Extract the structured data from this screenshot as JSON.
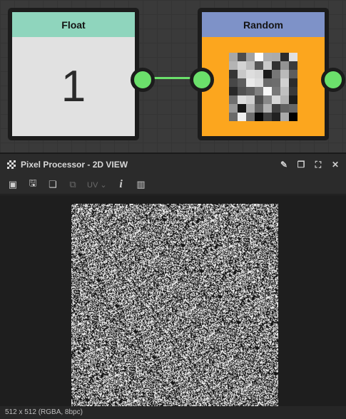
{
  "graph": {
    "nodes": [
      {
        "title": "Float",
        "value": "1",
        "header_color": "#8fd5bd",
        "body_color": "#e1e1e1"
      },
      {
        "title": "Random",
        "header_color": "#7e92c8",
        "body_color": "#fca61e"
      }
    ],
    "port_color": "#6be06b"
  },
  "panel": {
    "title": "Pixel Processor - 2D VIEW",
    "title_icons": [
      "pin-icon",
      "restore-icon",
      "maximize-icon",
      "close-icon"
    ],
    "toolbar": {
      "uv_label": "UV",
      "items": [
        "view-options-icon",
        "save-icon",
        "copy-icon",
        "link-icon",
        "uv-dropdown",
        "info-icon",
        "histogram-icon"
      ]
    },
    "status": "512 x 512 (RGBA, 8bpc)"
  }
}
